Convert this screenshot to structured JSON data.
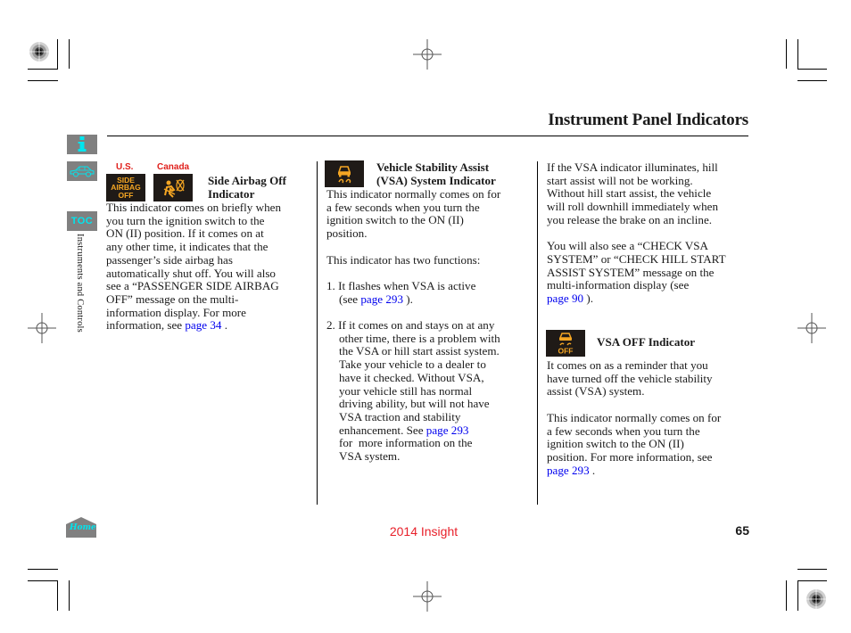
{
  "header": {
    "title": "Instrument Panel Indicators"
  },
  "sidebar": {
    "info_icon": "info-icon",
    "car_icon": "car-icon",
    "toc_label": "TOC",
    "section_label": "Instruments and Controls",
    "home_label": "Home"
  },
  "column1": {
    "region_us": "U.S.",
    "region_canada": "Canada",
    "us_indicator_text": [
      "SIDE",
      "AIRBAG",
      "OFF"
    ],
    "heading_line1": "Side Airbag Off",
    "heading_line2": "Indicator",
    "body": [
      "This indicator comes on briefly when",
      "you turn the ignition switch to the",
      "ON (II) position. If it comes on at",
      "any other time, it indicates that the",
      "passenger’s side airbag has",
      "automatically shut off. You will also",
      "see a “PASSENGER SIDE AIRBAG",
      "OFF” message on the multi-",
      "information display. For more"
    ],
    "last_line_prefix": "information, see ",
    "link": "page 34",
    "last_line_suffix": " ."
  },
  "column2": {
    "heading_line1": "Vehicle Stability Assist",
    "heading_line2": "(VSA) System Indicator",
    "para1": [
      "This indicator normally comes on for",
      "a few seconds when you turn the",
      "ignition switch to the ON (II)",
      "position."
    ],
    "para2": "This indicator has two functions:",
    "item1_line1": "1. It flashes when VSA is active",
    "item1_line2_prefix": "(see ",
    "item1_link": "page 293",
    "item1_line2_suffix": " ).",
    "item2_lines": [
      "2. If it comes on and stays on at any",
      "other time, there is a problem with",
      "the VSA or hill start assist system.",
      "Take your vehicle to a dealer to",
      "have it checked. Without VSA,",
      "your vehicle still has normal",
      "driving ability, but will not have",
      "VSA traction and stability"
    ],
    "item2_link_prefix": "enhancement. See ",
    "item2_link": "page 293",
    "item2_after": [
      "for  more information on the",
      "VSA system."
    ]
  },
  "column3": {
    "para1": [
      "If the VSA indicator illuminates, hill",
      "start assist will not be working.",
      "Without hill start assist, the vehicle",
      "will roll downhill immediately when",
      "you release the brake on an incline."
    ],
    "para2": [
      "You will also see a “CHECK VSA",
      "SYSTEM” or “CHECK HILL START",
      "ASSIST SYSTEM” message on the",
      "multi-information display (see"
    ],
    "para2_link": "page 90",
    "para2_suffix": " ).",
    "vsa_off_indicator_text": "OFF",
    "heading": "VSA OFF Indicator",
    "para3": [
      "It comes on as a reminder that you",
      "have turned off the vehicle stability",
      "assist (VSA) system."
    ],
    "para4": [
      "This indicator normally comes on for",
      "a few seconds when you turn the",
      "ignition switch to the ON (II)",
      "position. For more information, see"
    ],
    "para4_link": "page 293",
    "para4_suffix": " ."
  },
  "footer": {
    "model": "2014 Insight",
    "page_number": "65"
  },
  "colors": {
    "link": "#0000ee",
    "footer_model": "#e8202a",
    "region_label": "#e0201c",
    "indicator_bg": "#1f1a17",
    "indicator_amber": "#f5a623",
    "nav_button": "#808080",
    "nav_accent": "#00e5ee"
  }
}
